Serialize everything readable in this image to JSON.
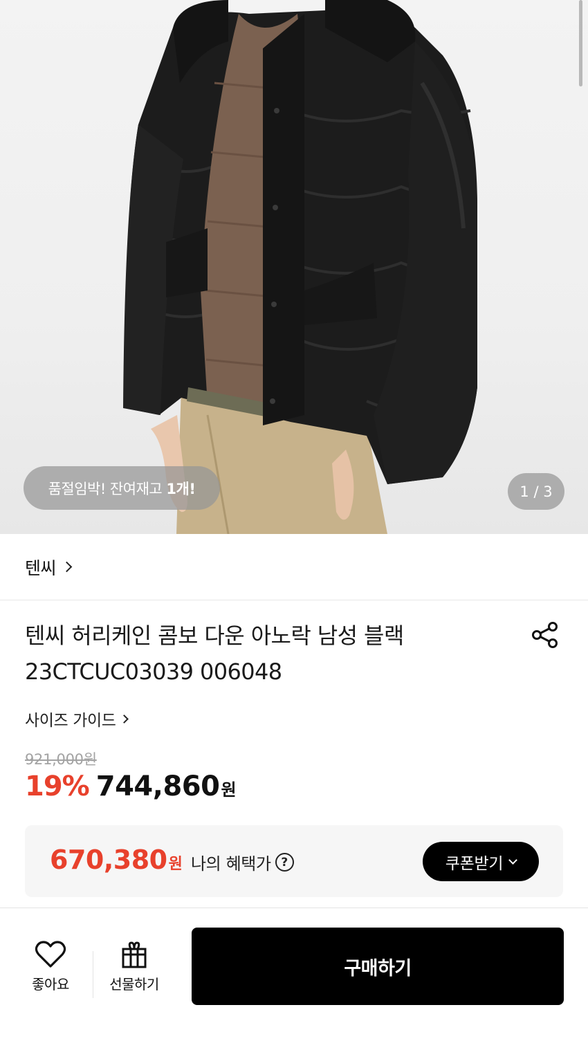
{
  "gallery": {
    "stock_text": "품절임박! 잔여재고 ",
    "stock_count": "1개!",
    "counter": "1 / 3",
    "current_image": 1,
    "total_images": 3
  },
  "brand": {
    "name": "텐씨"
  },
  "product": {
    "title_line1": "텐씨 허리케인 콤보 다운 아노락 남성 블랙",
    "title_line2": "23CTCUC03039 006048",
    "size_guide": "사이즈 가이드",
    "original_price": "921,000원",
    "discount": "19%",
    "sale_price": "744,860",
    "currency": "원"
  },
  "benefit": {
    "price": "670,380",
    "currency": "원",
    "label": "나의 혜택가",
    "help": "?",
    "coupon_button": "쿠폰받기"
  },
  "bottom_bar": {
    "like_label": "좋아요",
    "gift_label": "선물하기",
    "buy_label": "구매하기"
  },
  "colors": {
    "accent_red": "#e8412c",
    "button_black": "#000000",
    "badge_gray": "#969696"
  },
  "icons": {
    "share": "share-icon",
    "help": "help-circle-icon",
    "coupon_chevron": "chevron-down-icon",
    "like": "heart-icon",
    "gift": "gift-icon"
  }
}
